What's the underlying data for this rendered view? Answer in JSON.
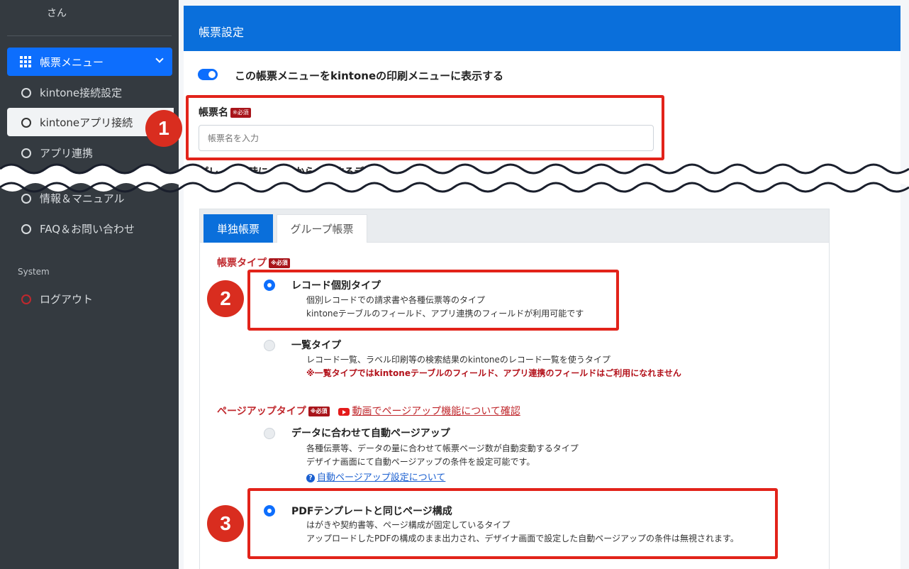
{
  "sidebar": {
    "user_suffix": "さん",
    "active_menu": "帳票メニュー",
    "items": [
      {
        "label": "kintone接続設定"
      },
      {
        "label": "kintoneアプリ接続"
      },
      {
        "label": "アプリ連携"
      },
      {
        "label": "情報＆マニュアル"
      },
      {
        "label": "FAQ＆お問い合わせ"
      }
    ],
    "section_label": "System",
    "logout_label": "ログアウト"
  },
  "header": {
    "title": "帳票設定"
  },
  "toggle": {
    "label": "この帳票メニューをkintoneの印刷メニューに表示する",
    "on": true
  },
  "form_name": {
    "label": "帳票名",
    "required": "※必須",
    "placeholder": "帳票名を入力"
  },
  "preview": {
    "label_partial": "プレ　　ー時に　　eから　　するデ"
  },
  "tabs": [
    {
      "label": "単独帳票"
    },
    {
      "label": "グループ帳票"
    }
  ],
  "form_type": {
    "title": "帳票タイプ",
    "required": "※必須",
    "options": [
      {
        "title": "レコード個別タイプ",
        "selected": true,
        "desc1": "個別レコードでの請求書や各種伝票等のタイプ",
        "desc2": "kintoneテーブルのフィールド、アプリ連携のフィールドが利用可能です"
      },
      {
        "title": "一覧タイプ",
        "selected": false,
        "desc1": "レコード一覧、ラベル印刷等の検索結果のkintoneのレコード一覧を使うタイプ",
        "warn": "※一覧タイプではkintoneテーブルのフィールド、アプリ連携のフィールドはご利用になれません"
      }
    ]
  },
  "page_up": {
    "title": "ページアップタイプ",
    "required": "※必須",
    "video_link": "動画でページアップ機能について確認",
    "options": [
      {
        "title": "データに合わせて自動ページアップ",
        "selected": false,
        "desc1": "各種伝票等、データの量に合わせて帳票ページ数が自動変動するタイプ",
        "desc2": "デザイナ画面にて自動ページアップの条件を設定可能です。",
        "help_link": "自動ページアップ設定について"
      },
      {
        "title": "PDFテンプレートと同じページ構成",
        "selected": true,
        "desc1": "はがきや契約書等、ページ構成が固定しているタイプ",
        "desc2": "アップロードしたPDFの構成のまま出力され、デザイナ画面で設定した自動ページアップの条件は無視されます。"
      }
    ]
  },
  "callouts": [
    "1",
    "2",
    "3"
  ],
  "colors": {
    "primary": "#0a6fdb",
    "sidebar": "#343a40",
    "callout": "#e2231a",
    "required": "#a8141a"
  }
}
